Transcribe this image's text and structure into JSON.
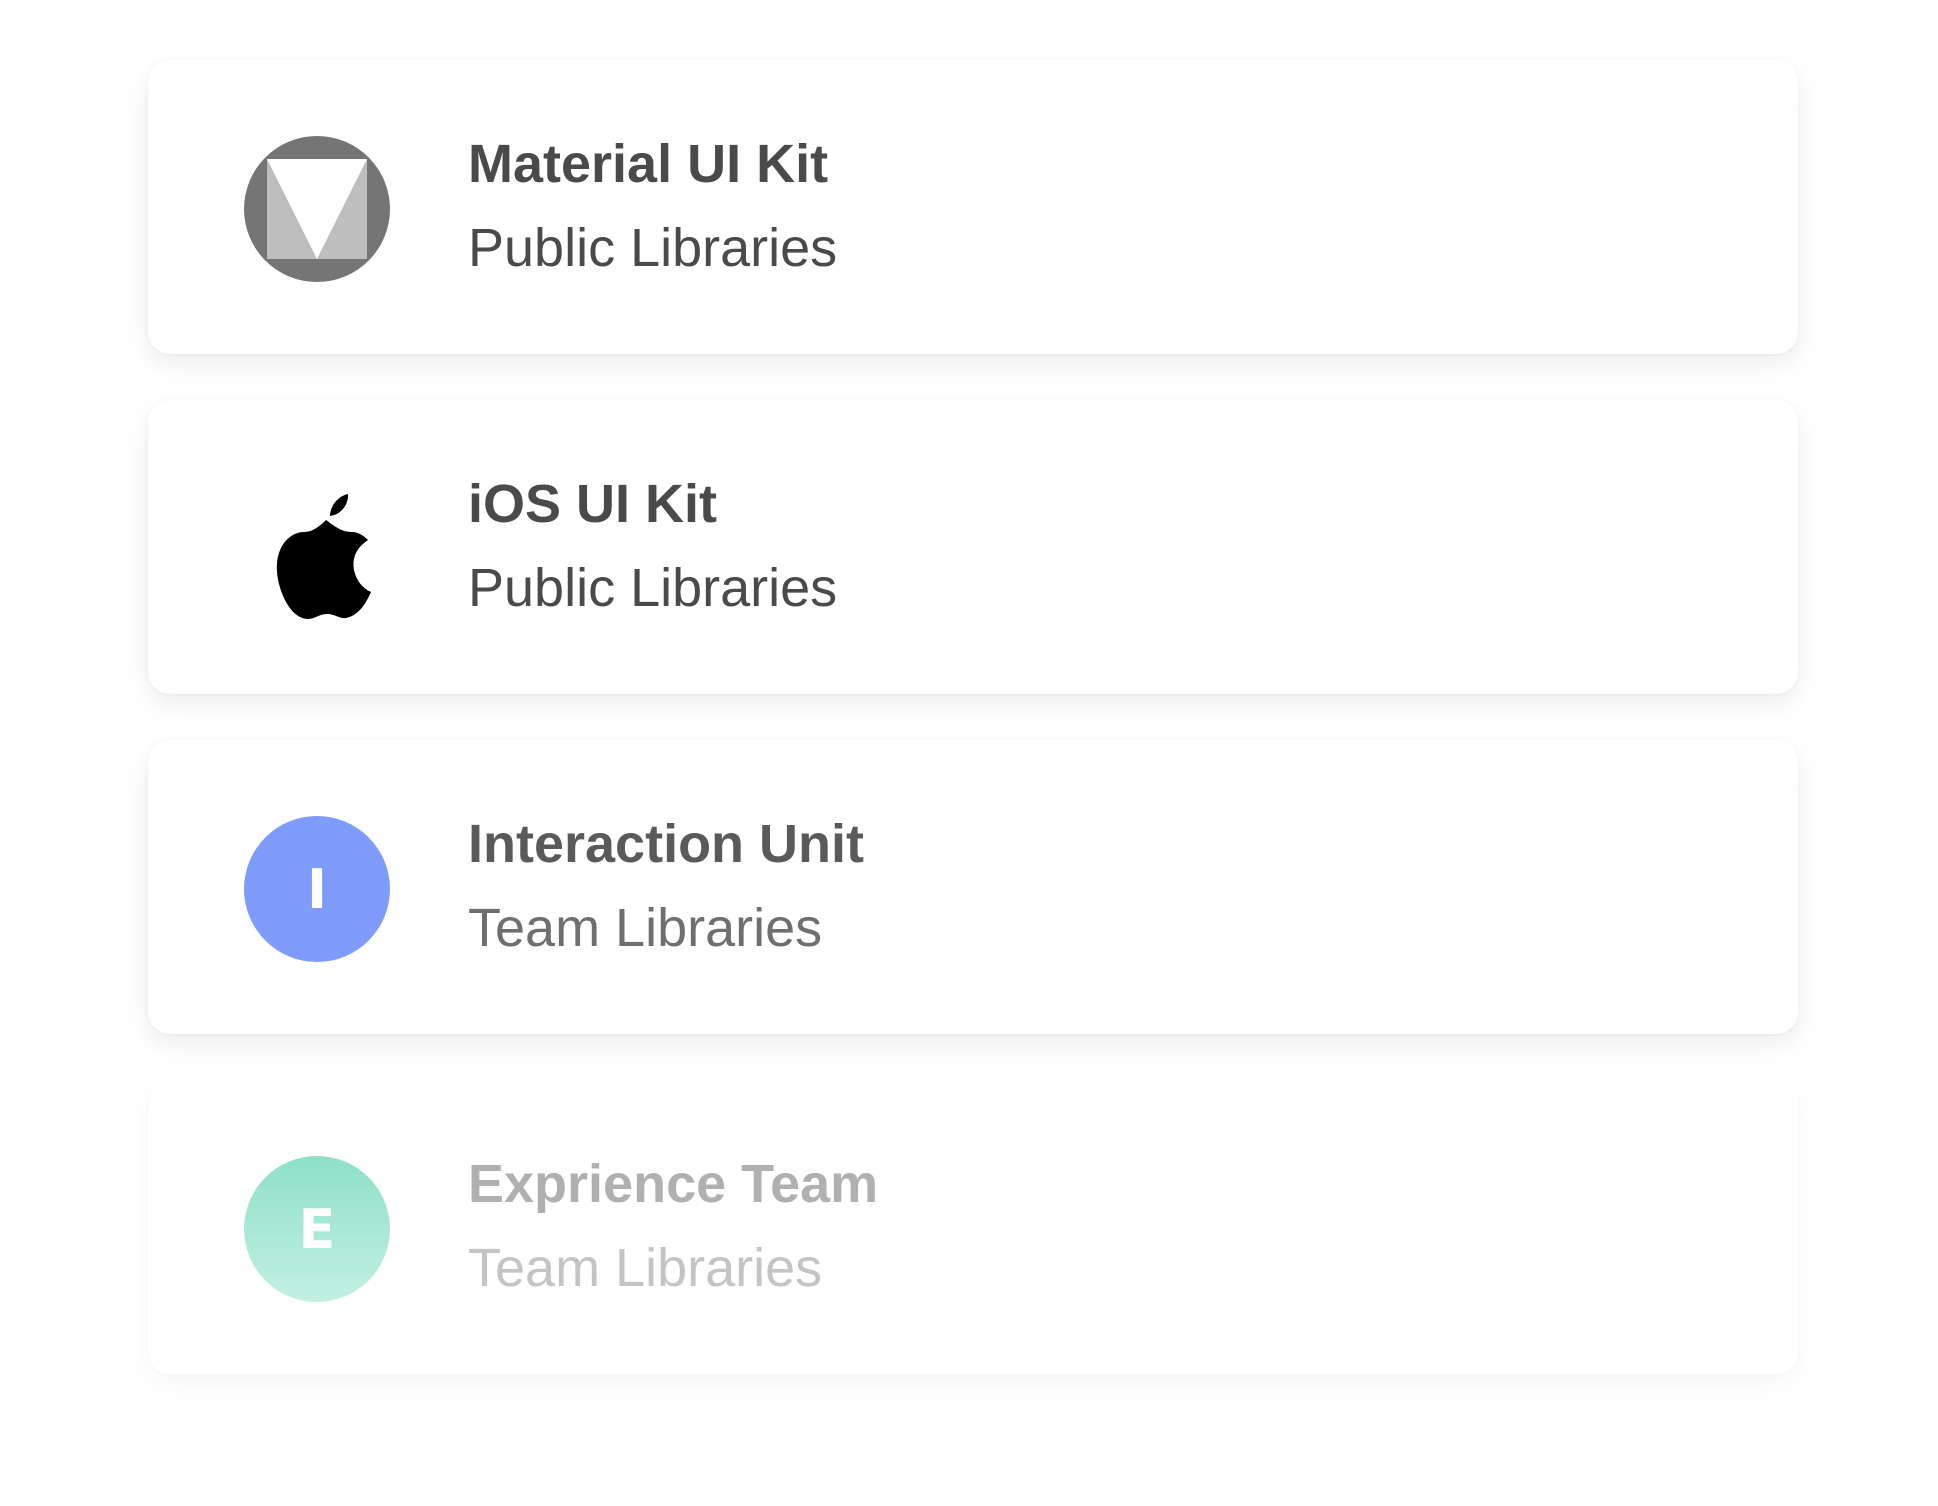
{
  "libraries": [
    {
      "title": "Material UI Kit",
      "subtitle": "Public Libraries",
      "icon": "material-logo-icon"
    },
    {
      "title": "iOS UI Kit",
      "subtitle": "Public Libraries",
      "icon": "apple-logo-icon"
    },
    {
      "title": "Interaction Unit",
      "subtitle": "Team Libraries",
      "avatar_letter": "I",
      "avatar_color": "#7f9bfb"
    },
    {
      "title": "Exprience Team",
      "subtitle": "Team Libraries",
      "avatar_letter": "E",
      "avatar_color_top": "#8fe0c8",
      "avatar_color_bottom": "#c2f0e3"
    }
  ]
}
